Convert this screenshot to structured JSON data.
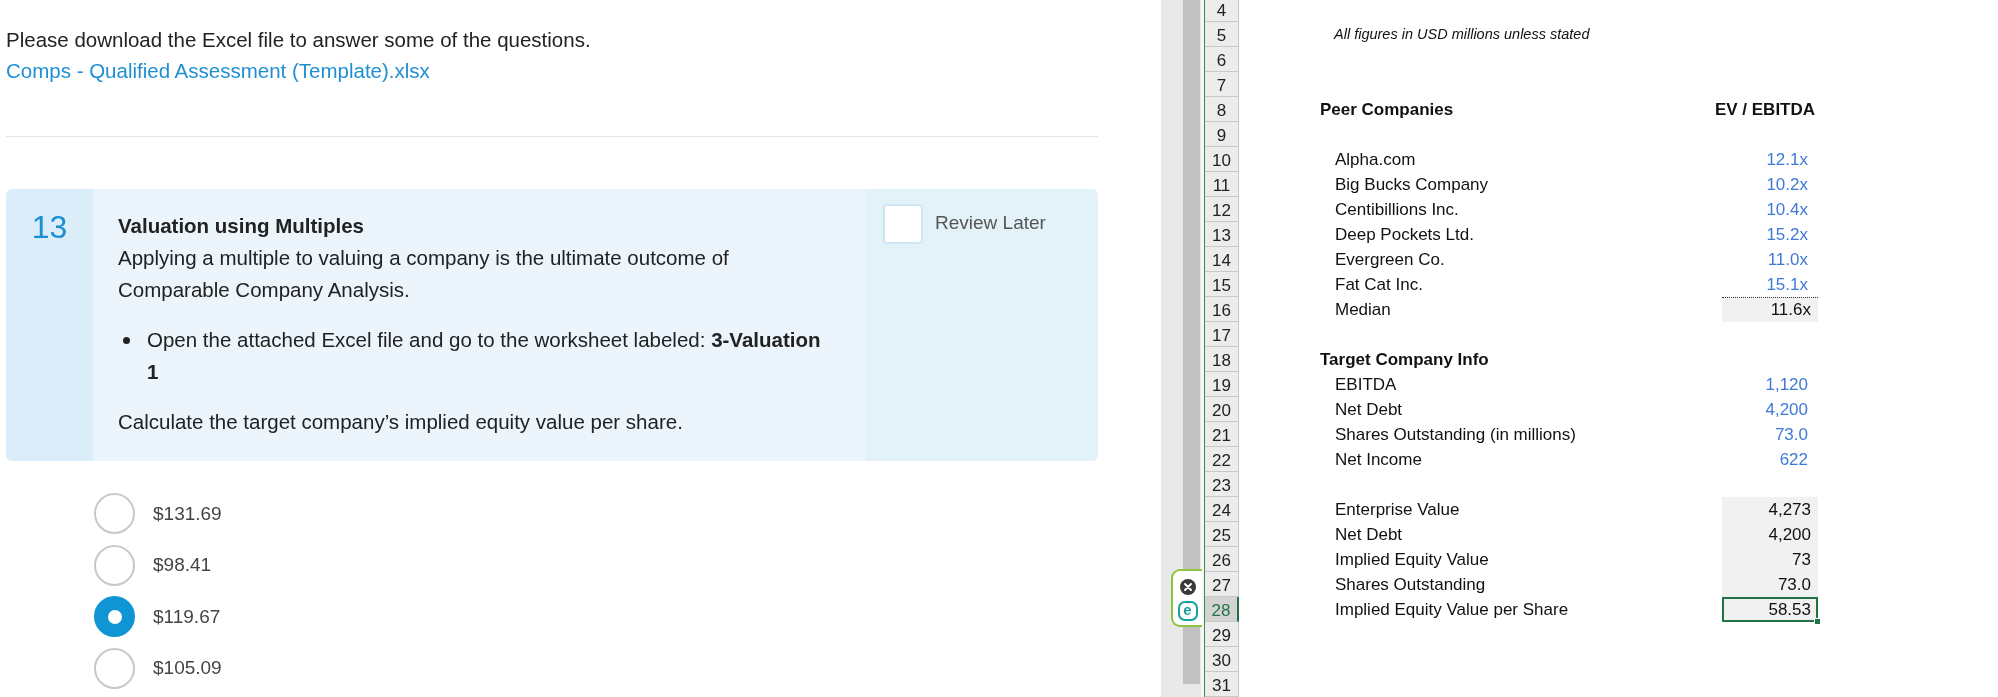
{
  "instructions": {
    "text": "Please download the Excel file to answer some of the questions.",
    "link": "Comps - Qualified Assessment (Template).xlsx"
  },
  "question": {
    "number": "13",
    "title": "Valuation using Multiples",
    "intro": "Applying a multiple to valuing a company is the ultimate outcome of Comparable Company Analysis.",
    "bullet": "Open the attached Excel file and go to the worksheet labeled: **3-Valuation 1**",
    "prompt": "Calculate the target company’s implied equity value per share.",
    "review_later": {
      "label": "Review Later",
      "checked": false
    }
  },
  "options": [
    {
      "label": "$131.69",
      "selected": false
    },
    {
      "label": "$98.41",
      "selected": false
    },
    {
      "label": "$119.67",
      "selected": true
    },
    {
      "label": "$105.09",
      "selected": false
    }
  ],
  "extension": {
    "logo_letter": "e"
  },
  "sheet": {
    "rows": [
      {
        "number": "4",
        "selected": false
      },
      {
        "number": "5",
        "selected": false,
        "kind": "note",
        "label": "All figures in USD millions unless stated"
      },
      {
        "number": "6",
        "selected": false
      },
      {
        "number": "7",
        "selected": false
      },
      {
        "number": "8",
        "selected": false,
        "kind": "heading",
        "label": "Peer Companies",
        "value": "EV / EBITDA"
      },
      {
        "number": "9",
        "selected": false
      },
      {
        "number": "10",
        "selected": false,
        "kind": "input",
        "label": "Alpha.com",
        "value": "12.1x"
      },
      {
        "number": "11",
        "selected": false,
        "kind": "input",
        "label": "Big Bucks Company",
        "value": "10.2x"
      },
      {
        "number": "12",
        "selected": false,
        "kind": "input",
        "label": "Centibillions Inc.",
        "value": "10.4x"
      },
      {
        "number": "13",
        "selected": false,
        "kind": "input",
        "label": "Deep Pockets Ltd.",
        "value": "15.2x"
      },
      {
        "number": "14",
        "selected": false,
        "kind": "input",
        "label": "Evergreen Co.",
        "value": "11.0x"
      },
      {
        "number": "15",
        "selected": false,
        "kind": "input",
        "label": "Fat Cat Inc.",
        "value": "15.1x"
      },
      {
        "number": "16",
        "selected": false,
        "kind": "summary",
        "label": "Median",
        "value": "11.6x"
      },
      {
        "number": "17",
        "selected": false
      },
      {
        "number": "18",
        "selected": false,
        "kind": "heading",
        "label": "Target Company Info"
      },
      {
        "number": "19",
        "selected": false,
        "kind": "input",
        "label": "EBITDA",
        "value": "1,120"
      },
      {
        "number": "20",
        "selected": false,
        "kind": "input",
        "label": "Net Debt",
        "value": "4,200"
      },
      {
        "number": "21",
        "selected": false,
        "kind": "input",
        "label": "Shares Outstanding (in millions)",
        "value": "73.0"
      },
      {
        "number": "22",
        "selected": false,
        "kind": "input",
        "label": "Net Income",
        "value": "622"
      },
      {
        "number": "23",
        "selected": false
      },
      {
        "number": "24",
        "selected": false,
        "kind": "output",
        "label": "Enterprise Value",
        "value": "4,273"
      },
      {
        "number": "25",
        "selected": false,
        "kind": "output",
        "label": "Net Debt",
        "value": "4,200"
      },
      {
        "number": "26",
        "selected": false,
        "kind": "output",
        "label": "Implied Equity Value",
        "value": "73"
      },
      {
        "number": "27",
        "selected": false,
        "kind": "output",
        "label": "Shares Outstanding",
        "value": "73.0"
      },
      {
        "number": "28",
        "selected": true,
        "kind": "output",
        "label": "Implied Equity Value per Share",
        "value": "58.53"
      },
      {
        "number": "29",
        "selected": false
      },
      {
        "number": "30",
        "selected": false
      },
      {
        "number": "31",
        "selected": false
      }
    ]
  }
}
